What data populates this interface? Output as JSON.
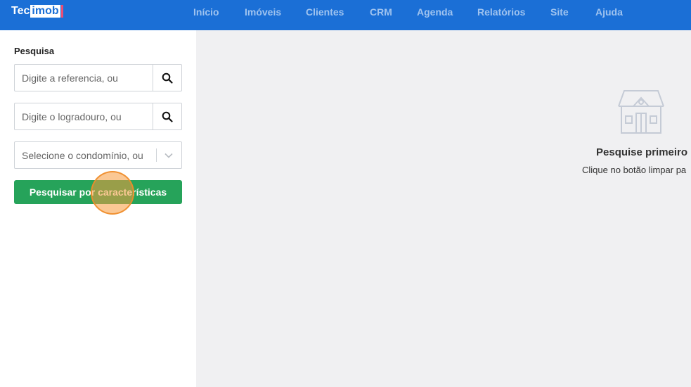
{
  "app": {
    "logo_left": "Tec",
    "logo_boxed": "imob",
    "brand_color": "#1b6fd6"
  },
  "nav": {
    "items": [
      "Início",
      "Imóveis",
      "Clientes",
      "CRM",
      "Agenda",
      "Relatórios",
      "Site",
      "Ajuda"
    ]
  },
  "sidebar": {
    "title": "Pesquisa",
    "reference_placeholder": "Digite a referencia, ou",
    "street_placeholder": "Digite o logradouro, ou",
    "condo_select": "Selecione o condomínio, ou",
    "search_by_features_label": "Pesquisar por características",
    "button_color": "#26a35a"
  },
  "main": {
    "empty_title": "Pesquise primeiro",
    "empty_subtitle": "Clique no botão limpar pa"
  },
  "icons": {
    "search": "search-icon",
    "chevron": "chevron-down-icon",
    "house": "house-icon"
  }
}
